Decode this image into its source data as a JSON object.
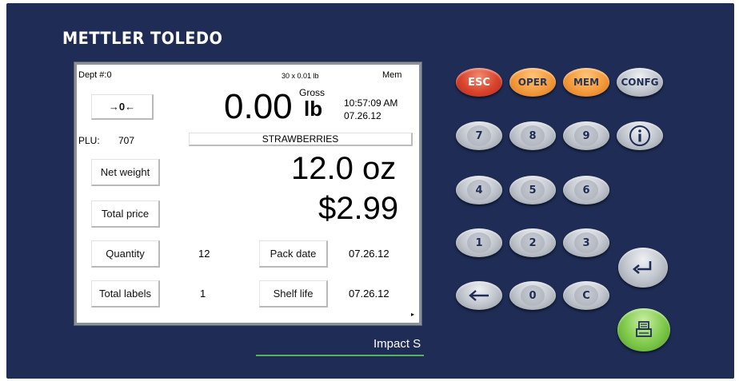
{
  "brand": "METTLER TOLEDO",
  "model": "Impact S",
  "screen": {
    "dept": "Dept #:0",
    "increment": "30 x 0.01 lb",
    "mem": "Mem",
    "zero_key": "→0←",
    "weight_value": "0.00",
    "weight_mode": "Gross",
    "weight_unit": "lb",
    "time": "10:57:09 AM",
    "date": "07.26.12",
    "plu_label": "PLU:",
    "plu_value": "707",
    "product": "STRAWBERRIES",
    "net_weight_label": "Net weight",
    "net_weight_value": "12.0 oz",
    "total_price_label": "Total price",
    "total_price_value": "$2.99",
    "quantity_label": "Quantity",
    "quantity_value": "12",
    "pack_date_label": "Pack date",
    "pack_date_value": "07.26.12",
    "total_labels_label": "Total labels",
    "total_labels_value": "1",
    "shelf_life_label": "Shelf life",
    "shelf_life_value": "07.26.12"
  },
  "keys": {
    "esc": "ESC",
    "oper": "OPER",
    "mem": "MEM",
    "config": "CONFG",
    "k7": "7",
    "k8": "8",
    "k9": "9",
    "k4": "4",
    "k5": "5",
    "k6": "6",
    "k1": "1",
    "k2": "2",
    "k3": "3",
    "k0": "0",
    "kc": "C"
  },
  "colors": {
    "panel": "#1f2d56",
    "esc": "#d9432d",
    "function_keys": "#f39a3d",
    "print_key": "#7fc94a",
    "model_underline": "#59b35a"
  }
}
